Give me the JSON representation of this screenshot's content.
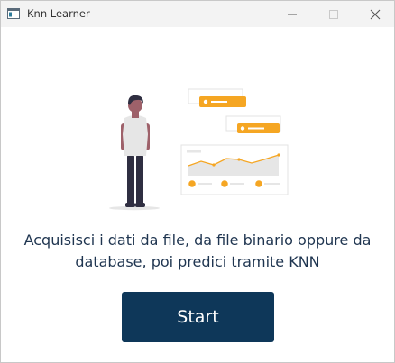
{
  "window": {
    "title": "Knn Learner"
  },
  "icons": {
    "app": "app-window-icon",
    "minimize": "minimize-icon",
    "maximize": "maximize-icon",
    "close": "close-icon"
  },
  "illustration": {
    "name": "person-with-charts-illustration",
    "accent_color": "#f5a623",
    "figure_color": "#2f2e41",
    "shirt_color": "#e6e6e6",
    "skin_color": "#9e616a"
  },
  "main": {
    "description": "Acquisisci i dati da file, da file binario oppure da database, poi predici tramite KNN",
    "start_label": "Start"
  },
  "colors": {
    "button_bg": "#0e3759",
    "text": "#1f3550",
    "titlebar_bg": "#f3f3f3"
  }
}
